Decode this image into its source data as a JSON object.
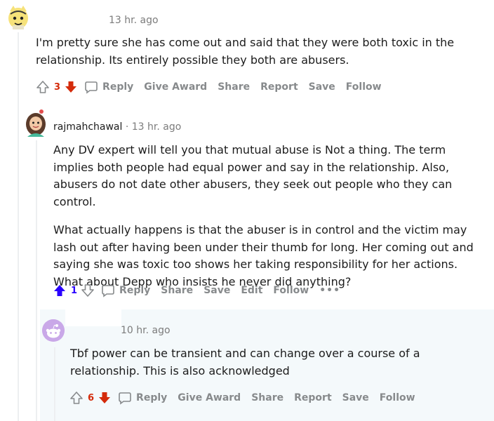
{
  "colors": {
    "upvote_active": "#2a00ff",
    "downvote_active": "#d42b0b",
    "meta": "#7c7c7c",
    "action": "#878a8c"
  },
  "comment1": {
    "timestamp": "13 hr. ago",
    "text": "I'm pretty sure she has come out and said that they were both toxic in the relationship. Its entirely possible they both are abusers.",
    "votes": "3",
    "vote_state": "downvoted",
    "actions": {
      "reply": "Reply",
      "give_award": "Give Award",
      "share": "Share",
      "report": "Report",
      "save": "Save",
      "follow": "Follow"
    }
  },
  "comment2": {
    "username": "rajmahchawal",
    "separator": "·",
    "timestamp": "13 hr. ago",
    "paragraphs": [
      "Any DV expert will tell you that mutual abuse is Not a thing. The term implies both people had equal power and say in the relationship. Also, abusers do not date other abusers, they seek out people who they can control.",
      "What actually happens is that the abuser is in control and the victim may lash out after having been under their thumb for long. Her coming out and saying she was toxic too shows her taking responsibility for her actions. What about Depp who insists he never did anything?"
    ],
    "votes": "1",
    "vote_state": "upvoted",
    "actions": {
      "reply": "Reply",
      "share": "Share",
      "save": "Save",
      "edit": "Edit",
      "follow": "Follow",
      "more": "•••"
    }
  },
  "comment3": {
    "timestamp": "10 hr. ago",
    "text": "Tbf power can be transient and can change over a course of a relationship. This is also acknowledged",
    "votes": "6",
    "vote_state": "downvoted",
    "actions": {
      "reply": "Reply",
      "give_award": "Give Award",
      "share": "Share",
      "report": "Report",
      "save": "Save",
      "follow": "Follow"
    }
  }
}
